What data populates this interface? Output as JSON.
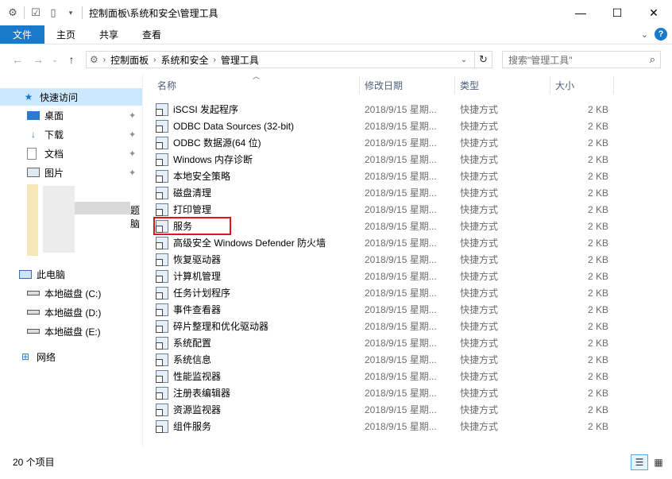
{
  "window": {
    "title": "控制面板\\系统和安全\\管理工具"
  },
  "ribbon": {
    "tabs": [
      "文件",
      "主页",
      "共享",
      "查看"
    ]
  },
  "address": {
    "crumbs": [
      "控制面板",
      "系统和安全",
      "管理工具"
    ]
  },
  "search": {
    "placeholder": "搜索\"管理工具\""
  },
  "sidebar": {
    "quick_access": "快速访问",
    "pinned": [
      "桌面",
      "下载",
      "文档",
      "图片"
    ],
    "blurred_label_tail": "题脑",
    "this_pc": "此电脑",
    "drives": [
      "本地磁盘 (C:)",
      "本地磁盘 (D:)",
      "本地磁盘 (E:)"
    ],
    "network": "网络"
  },
  "columns": {
    "name": "名称",
    "date": "修改日期",
    "type": "类型",
    "size": "大小"
  },
  "files": [
    {
      "name": "iSCSI 发起程序",
      "date": "2018/9/15 星期...",
      "type": "快捷方式",
      "size": "2 KB"
    },
    {
      "name": "ODBC Data Sources (32-bit)",
      "date": "2018/9/15 星期...",
      "type": "快捷方式",
      "size": "2 KB"
    },
    {
      "name": "ODBC 数据源(64 位)",
      "date": "2018/9/15 星期...",
      "type": "快捷方式",
      "size": "2 KB"
    },
    {
      "name": "Windows 内存诊断",
      "date": "2018/9/15 星期...",
      "type": "快捷方式",
      "size": "2 KB"
    },
    {
      "name": "本地安全策略",
      "date": "2018/9/15 星期...",
      "type": "快捷方式",
      "size": "2 KB"
    },
    {
      "name": "磁盘清理",
      "date": "2018/9/15 星期...",
      "type": "快捷方式",
      "size": "2 KB"
    },
    {
      "name": "打印管理",
      "date": "2018/9/15 星期...",
      "type": "快捷方式",
      "size": "2 KB"
    },
    {
      "name": "服务",
      "date": "2018/9/15 星期...",
      "type": "快捷方式",
      "size": "2 KB"
    },
    {
      "name": "高级安全 Windows Defender 防火墙",
      "date": "2018/9/15 星期...",
      "type": "快捷方式",
      "size": "2 KB"
    },
    {
      "name": "恢复驱动器",
      "date": "2018/9/15 星期...",
      "type": "快捷方式",
      "size": "2 KB"
    },
    {
      "name": "计算机管理",
      "date": "2018/9/15 星期...",
      "type": "快捷方式",
      "size": "2 KB"
    },
    {
      "name": "任务计划程序",
      "date": "2018/9/15 星期...",
      "type": "快捷方式",
      "size": "2 KB"
    },
    {
      "name": "事件查看器",
      "date": "2018/9/15 星期...",
      "type": "快捷方式",
      "size": "2 KB"
    },
    {
      "name": "碎片整理和优化驱动器",
      "date": "2018/9/15 星期...",
      "type": "快捷方式",
      "size": "2 KB"
    },
    {
      "name": "系统配置",
      "date": "2018/9/15 星期...",
      "type": "快捷方式",
      "size": "2 KB"
    },
    {
      "name": "系统信息",
      "date": "2018/9/15 星期...",
      "type": "快捷方式",
      "size": "2 KB"
    },
    {
      "name": "性能监视器",
      "date": "2018/9/15 星期...",
      "type": "快捷方式",
      "size": "2 KB"
    },
    {
      "name": "注册表编辑器",
      "date": "2018/9/15 星期...",
      "type": "快捷方式",
      "size": "2 KB"
    },
    {
      "name": "资源监视器",
      "date": "2018/9/15 星期...",
      "type": "快捷方式",
      "size": "2 KB"
    },
    {
      "name": "组件服务",
      "date": "2018/9/15 星期...",
      "type": "快捷方式",
      "size": "2 KB"
    }
  ],
  "status": {
    "count": "20 个项目"
  },
  "colors": {
    "accent": "#1979ca",
    "selection": "#cce8ff",
    "highlight_box": "#d7191c"
  },
  "icons": [
    "settings-icon",
    "properties-icon",
    "new-folder-icon",
    "quick-access-dropdown-icon",
    "minimize-icon",
    "maximize-icon",
    "close-icon",
    "expand-ribbon-icon",
    "help-icon",
    "back-icon",
    "forward-icon",
    "recent-dropdown-icon",
    "up-icon",
    "refresh-icon",
    "search-icon",
    "star-icon",
    "pin-icon",
    "drive-icon",
    "network-icon",
    "details-view-icon",
    "large-icons-view-icon"
  ]
}
